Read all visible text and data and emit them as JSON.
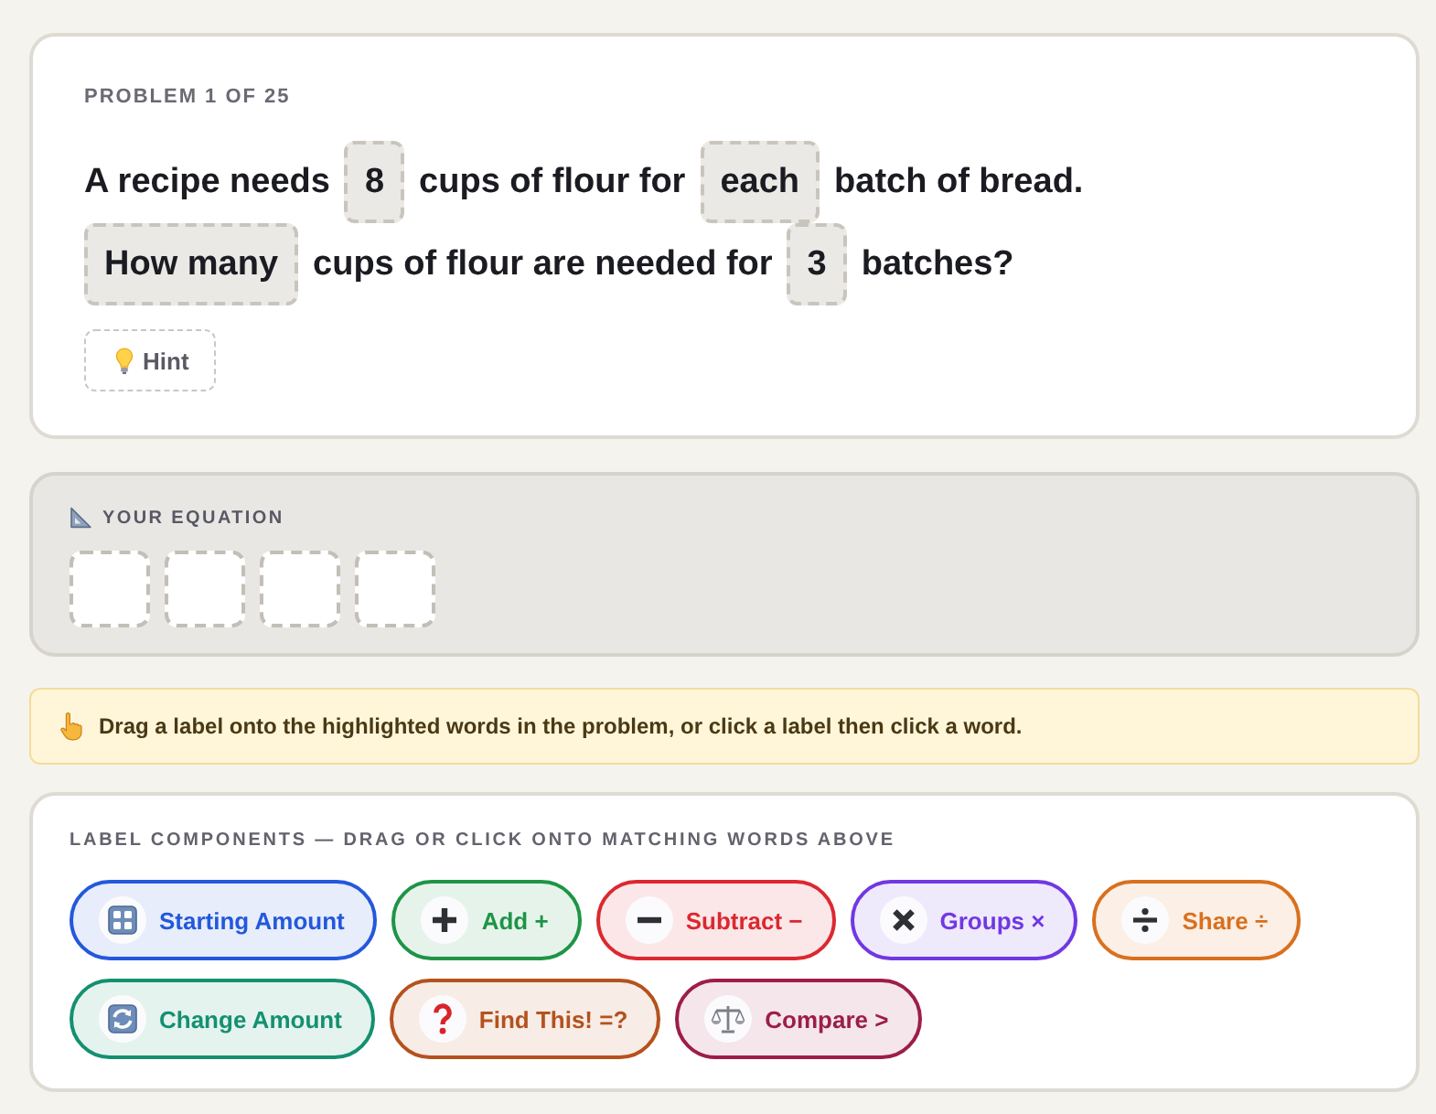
{
  "problem": {
    "counter": "PROBLEM 1 OF 25",
    "lines": [
      [
        {
          "kind": "text",
          "text": "A recipe needs"
        },
        {
          "kind": "target",
          "text": "8"
        },
        {
          "kind": "text",
          "text": "cups of flour for"
        },
        {
          "kind": "target",
          "text": "each"
        },
        {
          "kind": "text",
          "text": "batch of bread."
        }
      ],
      [
        {
          "kind": "target",
          "text": "How many"
        },
        {
          "kind": "text",
          "text": "cups of flour are needed for"
        },
        {
          "kind": "target",
          "text": "3"
        },
        {
          "kind": "text",
          "text": "batches?"
        }
      ]
    ],
    "hint": {
      "label": "Hint"
    }
  },
  "equation": {
    "title": "YOUR EQUATION",
    "slots": [
      {
        "kind": "empty"
      },
      {
        "kind": "empty"
      },
      {
        "kind": "empty"
      },
      {
        "kind": "empty"
      }
    ]
  },
  "tip": {
    "text": "Drag a label onto the highlighted words in the problem, or click a label then click a word."
  },
  "labels": {
    "title": "LABEL COMPONENTS — DRAG OR CLICK ONTO MATCHING WORDS ABOVE",
    "items": [
      {
        "kind": "start",
        "label": "Starting Amount",
        "color": "#2458dc"
      },
      {
        "kind": "add",
        "label": "Add +",
        "color": "#1e9446"
      },
      {
        "kind": "subtract",
        "label": "Subtract −",
        "color": "#dc2830"
      },
      {
        "kind": "groups",
        "label": "Groups ×",
        "color": "#7038e2"
      },
      {
        "kind": "share",
        "label": "Share ÷",
        "color": "#d9701e"
      },
      {
        "kind": "change",
        "label": "Change Amount",
        "color": "#149070"
      },
      {
        "kind": "find",
        "label": "Find This! =?",
        "color": "#b4521e"
      },
      {
        "kind": "compare",
        "label": "Compare >",
        "color": "#9d1d4a"
      }
    ]
  }
}
